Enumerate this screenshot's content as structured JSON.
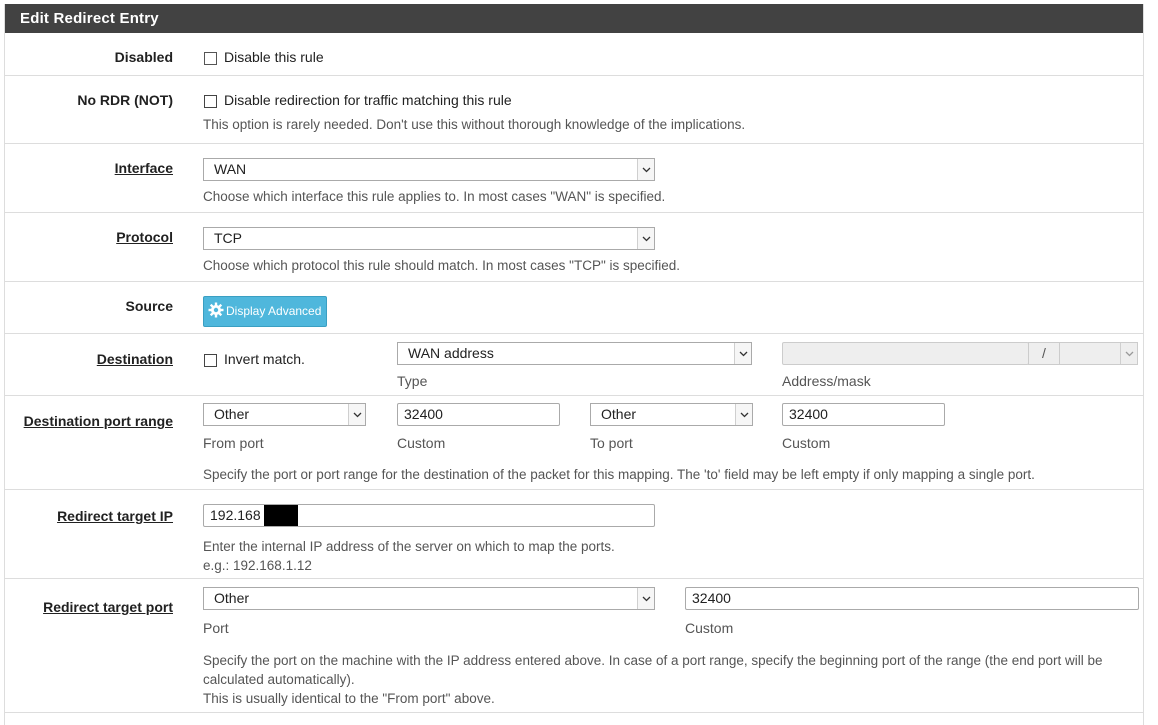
{
  "panel": {
    "title": "Edit Redirect Entry"
  },
  "disabled": {
    "label": "Disabled",
    "checkbox_text": "Disable this rule"
  },
  "nordr": {
    "label": "No RDR (NOT)",
    "checkbox_text": "Disable redirection for traffic matching this rule",
    "help": "This option is rarely needed. Don't use this without thorough knowledge of the implications."
  },
  "interface": {
    "label": "Interface",
    "value": "WAN",
    "help": "Choose which interface this rule applies to. In most cases \"WAN\" is specified."
  },
  "protocol": {
    "label": "Protocol",
    "value": "TCP",
    "help": "Choose which protocol this rule should match. In most cases \"TCP\" is specified."
  },
  "source": {
    "label": "Source",
    "button": "Display Advanced"
  },
  "destination": {
    "label": "Destination",
    "invert_text": "Invert match.",
    "type_value": "WAN address",
    "type_caption": "Type",
    "mask_separator": "/",
    "address_caption": "Address/mask"
  },
  "dest_port": {
    "label": "Destination port range",
    "from_select": "Other",
    "from_caption": "From port",
    "from_custom": "32400",
    "from_custom_caption": "Custom",
    "to_select": "Other",
    "to_caption": "To port",
    "to_custom": "32400",
    "to_custom_caption": "Custom",
    "help": "Specify the port or port range for the destination of the packet for this mapping. The 'to' field may be left empty if only mapping a single port."
  },
  "target_ip": {
    "label": "Redirect target IP",
    "value": "192.168",
    "help": "Enter the internal IP address of the server on which to map the ports.",
    "example": "e.g.: 192.168.1.12"
  },
  "target_port": {
    "label": "Redirect target port",
    "select": "Other",
    "select_caption": "Port",
    "custom": "32400",
    "custom_caption": "Custom",
    "help_line1": "Specify the port on the machine with the IP address entered above. In case of a port range, specify the beginning port of the range (the end port will be",
    "help_line2": "calculated automatically).",
    "help_line3": "This is usually identical to the \"From port\" above."
  },
  "colors": {
    "heading_bg": "#424242",
    "button_bg": "#4fb7dc",
    "border": "#dddddd"
  },
  "icons": {
    "select_arrow": "chevron-down-icon",
    "advanced": "gear-icon"
  }
}
